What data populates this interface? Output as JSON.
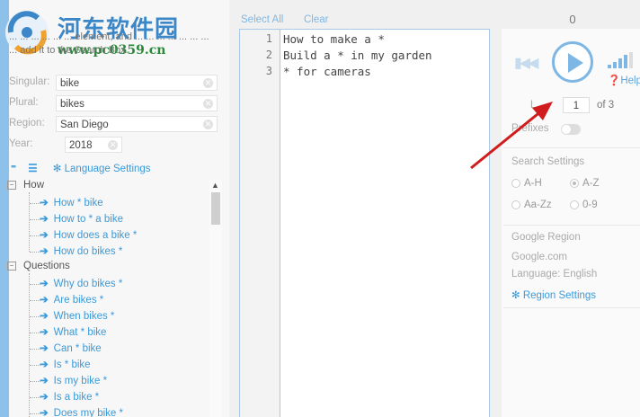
{
  "watermark": {
    "title": "河东软件园",
    "url": "www.pc0359.cn"
  },
  "left": {
    "instructions": "... ... ... ... ... ... element, and ... ... ... ... ... ... ... ... add it to the Search Box.",
    "fields": [
      {
        "label": "Singular:",
        "value": "bike"
      },
      {
        "label": "Plural:",
        "value": "bikes"
      },
      {
        "label": "Region:",
        "value": "San Diego"
      },
      {
        "label": "Year:",
        "value": "2018"
      }
    ],
    "language_settings": "Language Settings",
    "groups": [
      {
        "label": "How",
        "items": [
          "How * bike",
          "How to * a bike",
          "How does a bike *",
          "How do bikes *"
        ]
      },
      {
        "label": "Questions",
        "items": [
          "Why do bikes *",
          "Are bikes *",
          "When bikes *",
          "What * bike",
          "Can * bike",
          "Is * bike",
          "Is my bike *",
          "Is a bike *",
          "Does my bike *"
        ]
      }
    ]
  },
  "middle": {
    "select_all": "Select All",
    "clear": "Clear",
    "lines": [
      {
        "num": "1",
        "text": "How to make a *"
      },
      {
        "num": "2",
        "text": "Build a * in my garden"
      },
      {
        "num": "3",
        "text": "* for cameras"
      }
    ]
  },
  "right": {
    "count": "0",
    "help": "Help",
    "page_prefix": "L",
    "page_value": "1",
    "page_of": "of 3",
    "prefixes": "Prefixes",
    "search_settings": "Search Settings",
    "radios": [
      {
        "label": "A-H",
        "selected": false
      },
      {
        "label": "A-Z",
        "selected": true
      },
      {
        "label": "Aa-Zz",
        "selected": false
      },
      {
        "label": "0-9",
        "selected": false
      }
    ],
    "google_region": "Google Region",
    "google_domain": "Google.com",
    "language": "Language: English",
    "region_settings": "Region Settings"
  },
  "colors": {
    "accent": "#3a9ad9",
    "editor_border": "#aac8e8",
    "arrow": "#d01c1c"
  }
}
